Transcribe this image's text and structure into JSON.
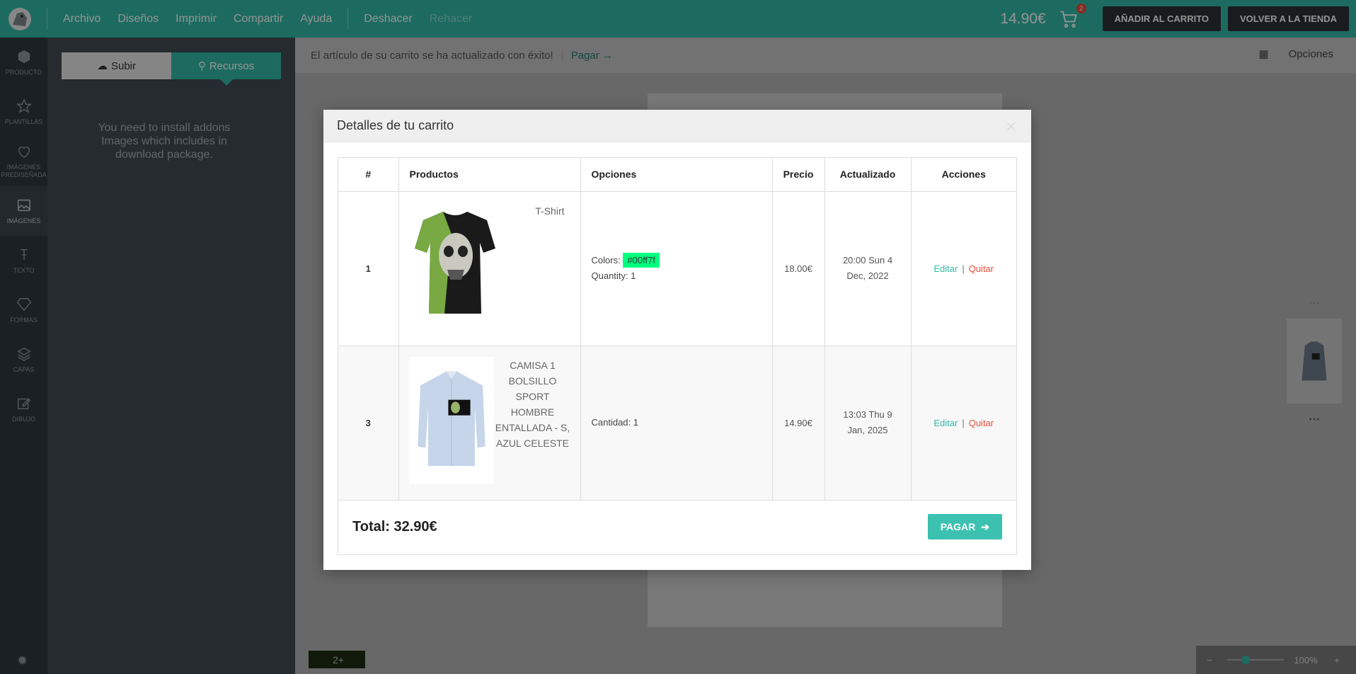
{
  "topbar": {
    "menu": [
      "Archivo",
      "Diseños",
      "Imprimir",
      "Compartir",
      "Ayuda",
      "Deshacer",
      "Rehacer"
    ],
    "price": "14.90€",
    "cart_count": "2",
    "add_to_cart": "AÑADIR AL CARRITO",
    "back_to_store": "VOLVER A LA TIENDA",
    "accent_color": "#33b8a5"
  },
  "sidebar": {
    "items": [
      {
        "label": "PRODUCTO",
        "icon": "cube-icon"
      },
      {
        "label": "PLANTILLAS",
        "icon": "star-icon"
      },
      {
        "label": "IMÁGENES PREDISEÑADA",
        "icon": "heart-icon"
      },
      {
        "label": "IMÁGENES",
        "icon": "image-icon"
      },
      {
        "label": "TEXTO",
        "icon": "text-icon"
      },
      {
        "label": "FORMAS",
        "icon": "diamond-icon"
      },
      {
        "label": "CAPAS",
        "icon": "layers-icon"
      },
      {
        "label": "DIBUJO",
        "icon": "edit-icon"
      }
    ]
  },
  "panel": {
    "tab_upload": "Subir",
    "tab_resources": "Recursos",
    "message": "You need to install addons Images which includes in download package."
  },
  "notice": {
    "text": "El artículo de su carrito se ha actualizado con éxito!",
    "pay": "Pagar"
  },
  "options_label": "Opciones",
  "bottom_badge": "2+",
  "zoom": "100%",
  "modal": {
    "title": "Detalles de tu carrito",
    "headers": [
      "#",
      "Productos",
      "Opciones",
      "Precio",
      "Actualizado",
      "Acciones"
    ],
    "rows": [
      {
        "num": "1",
        "product": "T-Shirt",
        "options_color_label": "Colors:",
        "options_color_value": "#00ff7f",
        "options_qty": "Quantity: 1",
        "price": "18.00€",
        "updated": "20:00 Sun 4 Dec, 2022",
        "edit": "Editar",
        "remove": "Quitar"
      },
      {
        "num": "3",
        "product": "CAMISA 1 BOLSILLO SPORT HOMBRE ENTALLADA - S, AZUL CELESTE",
        "options_qty": "Cantidad: 1",
        "price": "14.90€",
        "updated": "13:03 Thu 9 Jan, 2025",
        "edit": "Editar",
        "remove": "Quitar"
      }
    ],
    "total": "Total: 32.90€",
    "pay_button": "PAGAR"
  }
}
